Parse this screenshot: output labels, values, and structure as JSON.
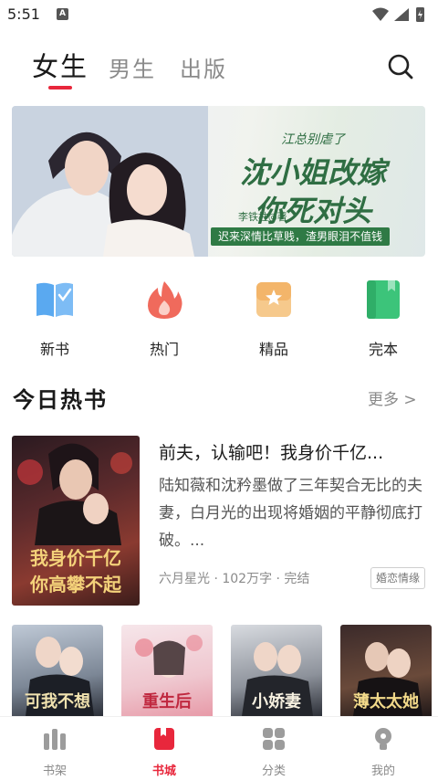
{
  "status": {
    "time": "5:51",
    "a_badge": "A"
  },
  "tabs": [
    {
      "label": "女生",
      "active": true
    },
    {
      "label": "男生",
      "active": false
    },
    {
      "label": "出版",
      "active": false
    }
  ],
  "banner": {
    "subtitle": "江总别虐了",
    "title_line1": "沈小姐改嫁",
    "title_line2": "你死对头",
    "author": "李铁柱◎著",
    "tagline": "迟来深情比草贱，渣男眼泪不值钱"
  },
  "quick_nav": [
    {
      "label": "新书",
      "icon": "new-book-icon",
      "color": "#5aa9f0"
    },
    {
      "label": "热门",
      "icon": "flame-icon",
      "color": "#f06a5c"
    },
    {
      "label": "精品",
      "icon": "star-bookmark-icon",
      "color": "#f3b56a"
    },
    {
      "label": "完本",
      "icon": "finished-book-icon",
      "color": "#3cc47a"
    }
  ],
  "section": {
    "title": "今日热书",
    "more": "更多 >"
  },
  "featured": {
    "title": "前夫，认输吧！我身价千亿...",
    "description": "陆知薇和沈矜墨做了三年契合无比的夫妻，白月光的出现将婚姻的平静彻底打破。...",
    "meta": "六月星光 · 102万字 · 完结",
    "tag": "婚恋情缘",
    "cover_text_line1": "我身价千亿",
    "cover_text_line2": "你高攀不起"
  },
  "covers": [
    {
      "text": "可我不想"
    },
    {
      "text": "重生后"
    },
    {
      "text": "小娇妻"
    },
    {
      "text": "薄太太她"
    }
  ],
  "bottom_nav": [
    {
      "label": "书架",
      "icon": "bookshelf-icon",
      "active": false
    },
    {
      "label": "书城",
      "icon": "bookstore-icon",
      "active": true
    },
    {
      "label": "分类",
      "icon": "category-grid-icon",
      "active": false
    },
    {
      "label": "我的",
      "icon": "profile-icon",
      "active": false
    }
  ],
  "colors": {
    "accent": "#e8273c",
    "banner_green": "#2f6e43"
  }
}
